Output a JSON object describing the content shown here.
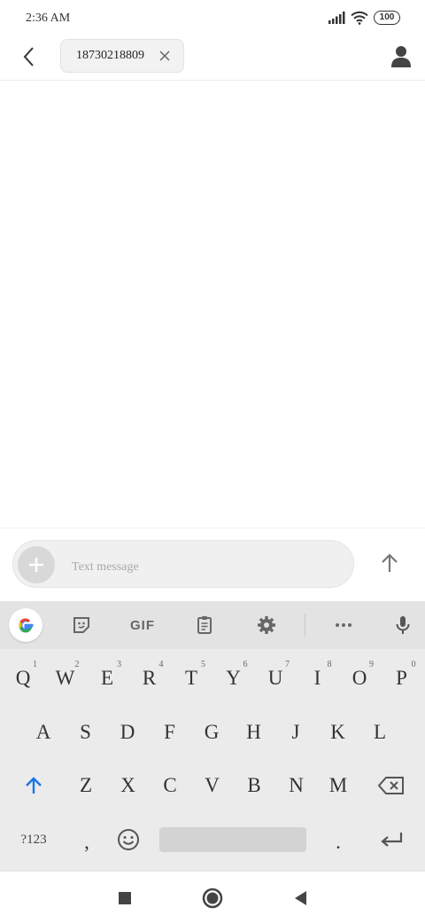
{
  "status_bar": {
    "time": "2:36 AM",
    "battery": "100",
    "icons": [
      "signal-icon",
      "wifi-icon",
      "battery-icon"
    ]
  },
  "header": {
    "back_icon": "back-arrow-icon",
    "recipient_chip": {
      "number": "18730218809",
      "remove_icon": "close-icon"
    },
    "contact_icon": "person-icon"
  },
  "compose": {
    "add_icon": "plus-icon",
    "placeholder": "Text message",
    "send_icon": "send-arrow-icon"
  },
  "keyboard": {
    "toolbar": {
      "items": [
        "google-icon",
        "sticker-icon",
        "gif",
        "clipboard-icon",
        "settings-icon",
        "more-icon",
        "mic-icon"
      ],
      "gif_label": "GIF"
    },
    "rows": [
      [
        {
          "label": "Q",
          "hint": "1"
        },
        {
          "label": "W",
          "hint": "2"
        },
        {
          "label": "E",
          "hint": "3"
        },
        {
          "label": "R",
          "hint": "4"
        },
        {
          "label": "T",
          "hint": "5"
        },
        {
          "label": "Y",
          "hint": "6"
        },
        {
          "label": "U",
          "hint": "7"
        },
        {
          "label": "I",
          "hint": "8"
        },
        {
          "label": "O",
          "hint": "9"
        },
        {
          "label": "P",
          "hint": "0"
        }
      ],
      [
        {
          "label": "A"
        },
        {
          "label": "S"
        },
        {
          "label": "D"
        },
        {
          "label": "F"
        },
        {
          "label": "G"
        },
        {
          "label": "H"
        },
        {
          "label": "J"
        },
        {
          "label": "K"
        },
        {
          "label": "L"
        }
      ],
      [
        {
          "label": "Z"
        },
        {
          "label": "X"
        },
        {
          "label": "C"
        },
        {
          "label": "V"
        },
        {
          "label": "B"
        },
        {
          "label": "N"
        },
        {
          "label": "M"
        }
      ]
    ],
    "shift_icon": "shift-arrow-icon",
    "backspace_icon": "backspace-icon",
    "symbols_label": "?123",
    "comma_label": ",",
    "period_label": ".",
    "emoji_icon": "emoji-icon",
    "enter_icon": "enter-icon",
    "accent_color": "#1a73e8"
  },
  "nav_bar": {
    "buttons": [
      "recents-square-icon",
      "home-circle-icon",
      "back-triangle-icon"
    ]
  }
}
